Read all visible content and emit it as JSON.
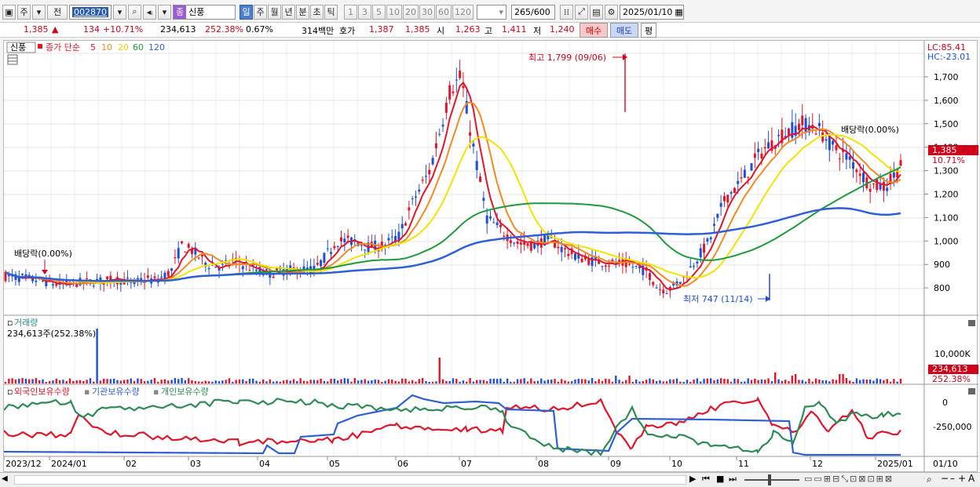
{
  "toolbar": {
    "period_type": "주",
    "market": "전",
    "stock_code": "002870",
    "stock_badge": "종",
    "stock_name": "신풍",
    "tabs": [
      {
        "label": "일",
        "selected": true
      },
      {
        "label": "주",
        "selected": false
      },
      {
        "label": "월",
        "selected": false
      },
      {
        "label": "년",
        "selected": false
      },
      {
        "label": "분",
        "selected": false
      },
      {
        "label": "초",
        "selected": false
      },
      {
        "label": "틱",
        "selected": false
      }
    ],
    "intervals": [
      "1",
      "3",
      "5",
      "10",
      "20",
      "30",
      "60",
      "120"
    ],
    "count": "265",
    "count_max": "/600",
    "date": "2025/01/10"
  },
  "quote": {
    "price": "1,385",
    "change_arrow": "▲",
    "change": "134",
    "change_rate": "+10.71%",
    "volume": "234,613",
    "volume_ratio": "252.38%",
    "turnover": "0.67%",
    "amount": "314백만",
    "hoga_label": "호가",
    "ask": "1,387",
    "bid": "1,385",
    "open_label": "시",
    "open": "1,263",
    "high_label": "고",
    "high": "1,411",
    "low_label": "저",
    "low": "1,240",
    "buy_label": "매수",
    "sell_label": "매도",
    "even_label": "평"
  },
  "price_panel": {
    "stock_tag": "신풍",
    "ma_label": "종가 단순",
    "ma_periods": [
      {
        "period": "5",
        "color": "#e0162b"
      },
      {
        "period": "10",
        "color": "#f08a24"
      },
      {
        "period": "20",
        "color": "#f2e300"
      },
      {
        "period": "60",
        "color": "#1f9a3a"
      },
      {
        "period": "120",
        "color": "#2f5fd6"
      }
    ],
    "lc": "LC:85.41",
    "hc": "HC:-23.01",
    "axis": [
      "1,700",
      "1,600",
      "1,500",
      "1,400",
      "1,300",
      "1,200",
      "1,100",
      "1,000",
      "900",
      "800"
    ],
    "current_price": "1,385",
    "current_rate": "10.71%",
    "high_note": "최고 1,799 (09/06)",
    "low_note": "최저 747 (11/14)",
    "dividend_left": "배당락(0.00%)",
    "dividend_right": "배당락(0.00%)"
  },
  "volume_panel": {
    "title": "거래량",
    "info": "234,613주(252.38%)",
    "axis": "10,000K",
    "current": "234,613",
    "ratio": "252.38%"
  },
  "holding_panel": {
    "series": [
      {
        "name": "외국인보유수량",
        "color": "#e0162b"
      },
      {
        "name": "기관보유수량",
        "color": "#2f5fd6"
      },
      {
        "name": "개인보유수량",
        "color": "#2e8b57"
      }
    ],
    "axis": [
      "0",
      "-250,000"
    ]
  },
  "x_axis": [
    "2023/12",
    "2024/01",
    "02",
    "03",
    "04",
    "05",
    "06",
    "07",
    "08",
    "09",
    "10",
    "11",
    "12",
    "2025/01"
  ],
  "x_axis_right": "01/10",
  "colors": {
    "up": "#e0162b",
    "down": "#1f4fd8",
    "panel_border": "#b8b8b8"
  }
}
